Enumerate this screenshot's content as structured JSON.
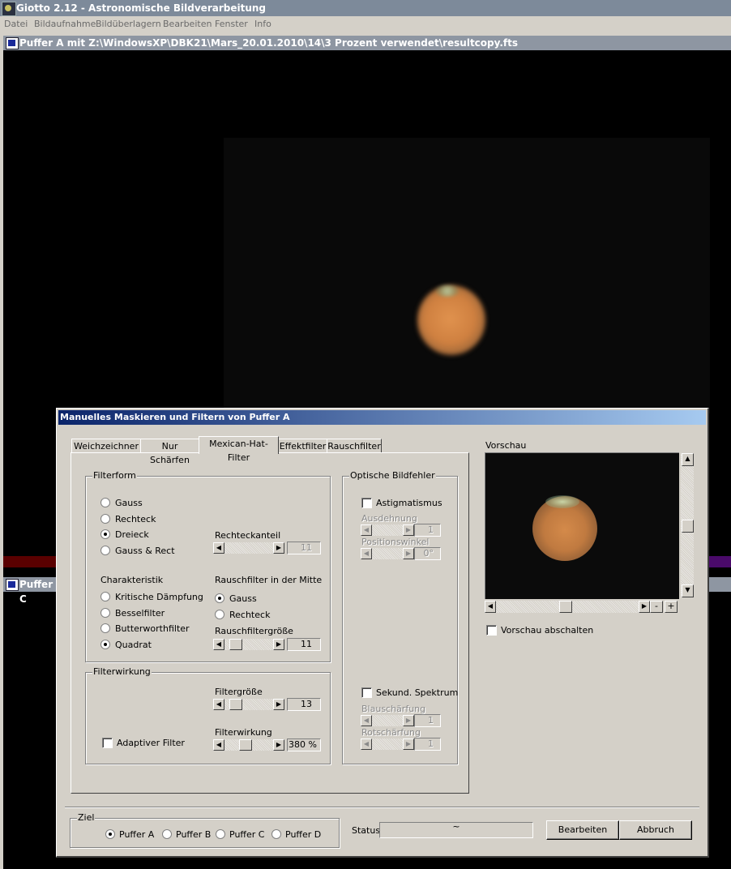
{
  "app": {
    "title": "Giotto 2.12 - Astronomische Bildverarbeitung",
    "menu": [
      "Datei",
      "Bildaufnahme",
      "Bildüberlagern",
      "Bearbeiten",
      "Fenster",
      "Info"
    ]
  },
  "buffer_a_title": "Puffer A mit Z:\\WindowsXP\\DBK21\\Mars_20.01.2010\\14\\3 Prozent verwendet\\resultcopy.fts",
  "buffer_c_title": "Puffer C",
  "dialog": {
    "title": "Manuelles Maskieren und Filtern von Puffer A",
    "tabs": [
      "Weichzeichner",
      "Nur Schärfen",
      "Mexican-Hat-Filter",
      "Effektfilter",
      "Rauschfilter"
    ],
    "active_tab": "Mexican-Hat-Filter",
    "filterform": {
      "title": "Filterform",
      "options": [
        "Gauss",
        "Rechteck",
        "Dreieck",
        "Gauss & Rect"
      ],
      "selected": "Dreieck",
      "rechteckanteil_label": "Rechteckanteil",
      "rechteckanteil_value": "11"
    },
    "charakteristik": {
      "title": "Charakteristik",
      "options": [
        "Kritische Dämpfung",
        "Besselfilter",
        "Butterworthfilter",
        "Quadrat"
      ],
      "selected": "Quadrat"
    },
    "rauschfilter_mitte": {
      "title": "Rauschfilter in der Mitte",
      "options": [
        "Gauss",
        "Rechteck"
      ],
      "selected": "Gauss",
      "size_label": "Rauschfiltergröße",
      "size_value": "11"
    },
    "filterwirkung": {
      "title": "Filterwirkung",
      "filtergroesse_label": "Filtergröße",
      "filtergroesse_value": "13",
      "wirkung_label": "Filterwirkung",
      "wirkung_value": "380 %",
      "adaptive_label": "Adaptiver Filter"
    },
    "optische_bildfehler": {
      "title": "Optische Bildfehler",
      "astigmatismus_label": "Astigmatismus",
      "ausdehnung_label": "Ausdehnung",
      "ausdehnung_value": "1",
      "positionswinkel_label": "Positionswinkel",
      "positionswinkel_value": "0°",
      "sekund_label": "Sekund. Spektrum",
      "blau_label": "Blauschärfung",
      "blau_value": "1",
      "rot_label": "Rotschärfung",
      "rot_value": "1"
    },
    "vorschau": {
      "title": "Vorschau",
      "off_label": "Vorschau abschalten",
      "zoom_out": "-",
      "zoom_in": "+"
    },
    "ziel": {
      "title": "Ziel",
      "options": [
        "Puffer A",
        "Puffer B",
        "Puffer C",
        "Puffer D"
      ],
      "selected": "Puffer A"
    },
    "status_label": "Status",
    "status_value": "~",
    "buttons": {
      "apply": "Bearbeiten",
      "cancel": "Abbruch"
    }
  }
}
